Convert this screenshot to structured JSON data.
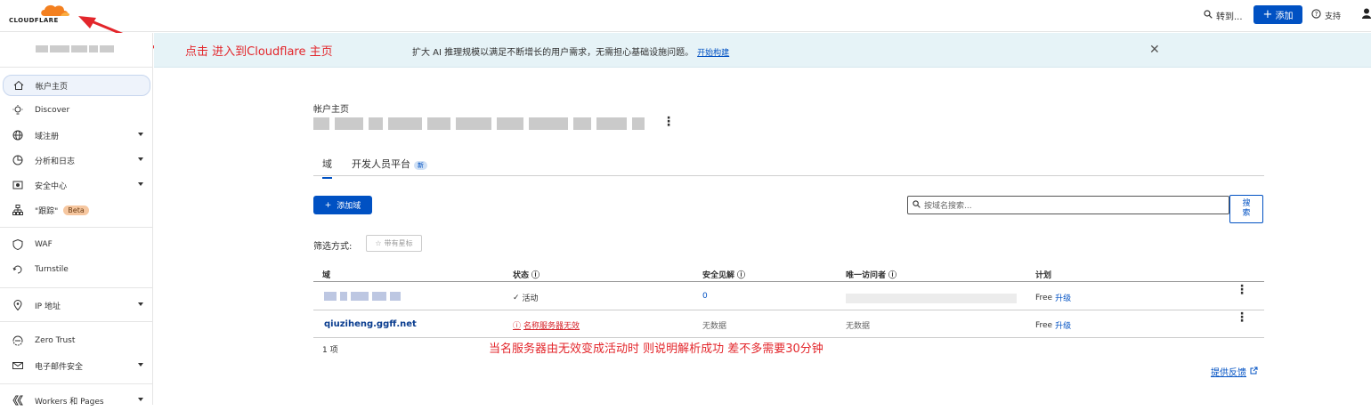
{
  "topbar": {
    "logo_text": "CLOUDFLARE",
    "search_label": "转到...",
    "add_label": "添加",
    "support_label": "支持"
  },
  "banner": {
    "annotation": "点击  进入到Cloudflare 主页",
    "message": "扩大 AI 推理规模以满足不断增长的用户需求，无需担心基础设施问题。",
    "link": "开始构建"
  },
  "sidebar": {
    "items": [
      {
        "label": "帐户主页",
        "icon": "home-icon"
      },
      {
        "label": "Discover",
        "icon": "lightbulb-icon"
      },
      {
        "label": "域注册",
        "icon": "globe-icon"
      },
      {
        "label": "分析和日志",
        "icon": "chart-icon"
      },
      {
        "label": "安全中心",
        "icon": "shield-icon"
      },
      {
        "label": "\"跟踪\"",
        "icon": "network-icon",
        "badge": "Beta"
      },
      {
        "label": "WAF",
        "icon": "waf-icon"
      },
      {
        "label": "Turnstile",
        "icon": "turnstile-icon"
      },
      {
        "label": "IP 地址",
        "icon": "location-icon"
      },
      {
        "label": "Zero Trust",
        "icon": "zero-trust-icon"
      },
      {
        "label": "电子邮件安全",
        "icon": "email-icon"
      },
      {
        "label": "Workers 和 Pages",
        "icon": "workers-icon"
      }
    ]
  },
  "main": {
    "page_title": "帐户主页",
    "tabs": [
      {
        "label": "域"
      },
      {
        "label": "开发人员平台",
        "badge": "新"
      }
    ],
    "add_site_label": "添加域",
    "search_placeholder": "按域名搜索...",
    "search_button": "搜索",
    "filter_label": "筛选方式:",
    "star_filter": "带有星标",
    "columns": [
      "域",
      "状态",
      "安全见解",
      "唯一访问者",
      "计划"
    ],
    "rows": [
      {
        "domain": "",
        "status": "活动",
        "insights": "0",
        "visitors": "",
        "plan": "Free",
        "upgrade": "升级"
      },
      {
        "domain": "qiuziheng.ggff.net",
        "status": "名称服务器无效",
        "insights": "无数据",
        "visitors": "无数据",
        "plan": "Free",
        "upgrade": "升级"
      }
    ],
    "count": "1 项",
    "annotation": "当名服务器由无效变成活动时  则说明解析成功 差不多需要30分钟",
    "feedback": "提供反馈"
  },
  "colors": {
    "accent": "#0051c3",
    "annotation": "#e3262b",
    "banner_bg": "#e6f3f7",
    "logo_orange": "#f38020"
  }
}
